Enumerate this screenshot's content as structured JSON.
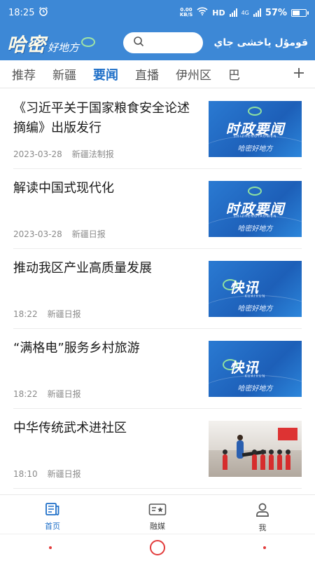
{
  "status": {
    "time": "18:25",
    "net_speed_top": "0.00",
    "net_speed_bottom": "KB/S",
    "hd_label": "HD",
    "lte_label": "4G",
    "battery": "57%",
    "battery_level": 0.57
  },
  "header": {
    "logo_main": "哈密",
    "logo_sub": "好地方",
    "uyghur_title": "قومۇل ياخشى جاي"
  },
  "tabs": [
    {
      "label": "推荐"
    },
    {
      "label": "新疆"
    },
    {
      "label": "要闻",
      "active": true
    },
    {
      "label": "直播"
    },
    {
      "label": "伊州区"
    },
    {
      "label": "巴"
    }
  ],
  "news": [
    {
      "title": "《习近平关于国家粮食安全论述摘编》出版发行",
      "date": "2023-03-28",
      "source": "新疆法制报",
      "thumb": {
        "kind": "shizheng",
        "text": "时政要闻",
        "pinyin": "SHIZHENGYAOWEN",
        "brand": "哈密好地方"
      }
    },
    {
      "title": "解读中国式现代化",
      "date": "2023-03-28",
      "source": "新疆日报",
      "thumb": {
        "kind": "shizheng",
        "text": "时政要闻",
        "pinyin": "SHIZHENGYAOWEN",
        "brand": "哈密好地方"
      }
    },
    {
      "title": "推动我区产业高质量发展",
      "date": "18:22",
      "source": "新疆日报",
      "thumb": {
        "kind": "kuaixun",
        "text": "快讯",
        "pinyin": "KUAIXUN",
        "brand": "哈密好地方"
      }
    },
    {
      "title": "“满格电”服务乡村旅游",
      "date": "18:22",
      "source": "新疆日报",
      "thumb": {
        "kind": "kuaixun",
        "text": "快讯",
        "pinyin": "KUAIXUN",
        "brand": "哈密好地方"
      }
    },
    {
      "title": "中华传统武术进社区",
      "date": "18:10",
      "source": "新疆日报",
      "thumb": {
        "kind": "photo"
      }
    }
  ],
  "bottom_nav": [
    {
      "label": "首页",
      "icon": "newspaper-icon",
      "active": true
    },
    {
      "label": "融媒",
      "icon": "media-card-icon"
    },
    {
      "label": "我",
      "icon": "person-icon"
    }
  ]
}
